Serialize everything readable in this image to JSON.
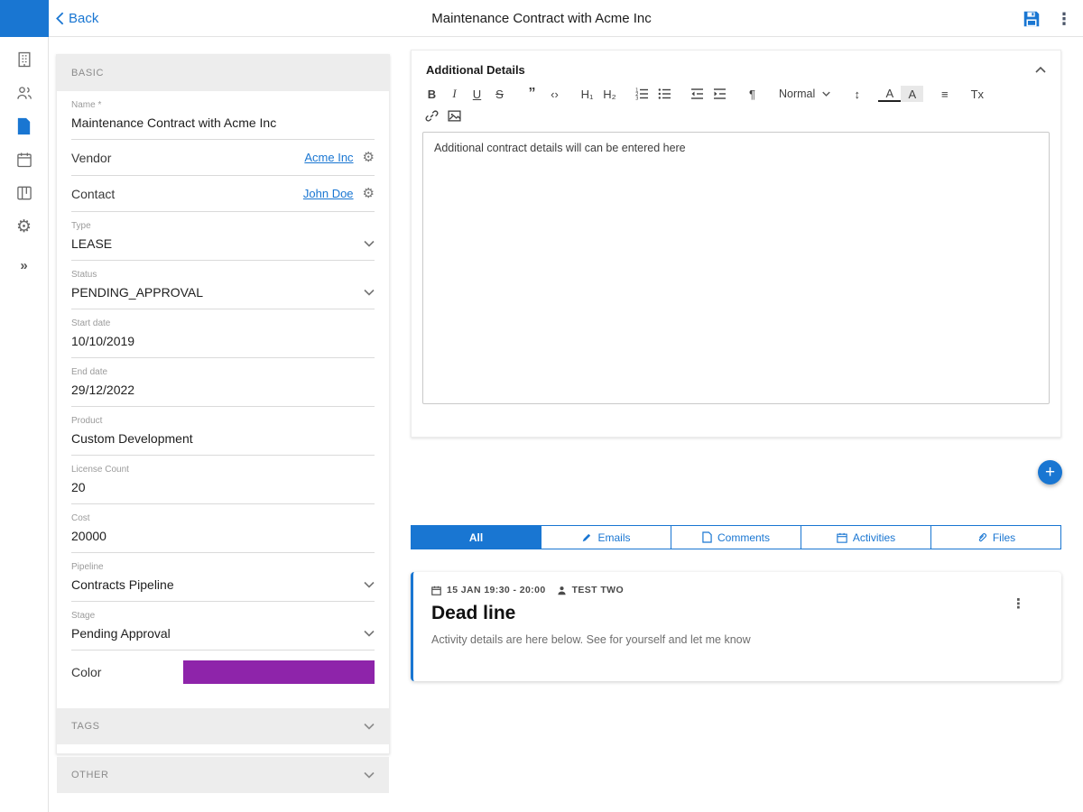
{
  "app_bar": {
    "back_label": "Back",
    "title": "Maintenance Contract with Acme Inc"
  },
  "sidebar": {
    "icons": [
      "building-icon",
      "contacts-icon",
      "document-icon",
      "calendar-icon",
      "kanban-icon",
      "gear-icon",
      "chevrons-right-icon"
    ],
    "active_item": "documents"
  },
  "form": {
    "section_basic": "BASIC",
    "section_tags": "TAGS",
    "section_other": "OTHER",
    "fields": {
      "name": {
        "label": "Name *",
        "value": "Maintenance Contract with Acme Inc"
      },
      "vendor": {
        "label": "Vendor",
        "link": "Acme Inc"
      },
      "contact": {
        "label": "Contact",
        "link": "John Doe"
      },
      "type": {
        "label": "Type",
        "value": "LEASE"
      },
      "status": {
        "label": "Status",
        "value": "PENDING_APPROVAL"
      },
      "start_date": {
        "label": "Start date",
        "value": "10/10/2019"
      },
      "end_date": {
        "label": "End date",
        "value": "29/12/2022"
      },
      "product": {
        "label": "Product",
        "value": "Custom Development"
      },
      "license_count": {
        "label": "License Count",
        "value": "20"
      },
      "cost": {
        "label": "Cost",
        "value": "20000"
      },
      "pipeline": {
        "label": "Pipeline",
        "value": "Contracts Pipeline"
      },
      "stage": {
        "label": "Stage",
        "value": "Pending Approval"
      },
      "color": {
        "label": "Color",
        "swatch_color": "#8e24aa"
      }
    }
  },
  "editor": {
    "title": "Additional Details",
    "content": "Additional contract details will can be entered here",
    "toolbar": {
      "bold": "B",
      "italic": "I",
      "underline": "U",
      "strike": "S",
      "blockquote": "”",
      "code": "‹›",
      "h1": "H₁",
      "h2": "H₂",
      "direction": "¶",
      "format": "Normal",
      "size": "↕",
      "color": "A",
      "background": "A",
      "align": "≡",
      "clean": "Tx"
    },
    "toolbar_icons": [
      "ordered-list-icon",
      "bullet-list-icon",
      "outdent-icon",
      "indent-icon",
      "link-icon",
      "image-icon"
    ]
  },
  "tabs": [
    {
      "label": "All",
      "active": true
    },
    {
      "label": "Emails",
      "icon": "pen-icon"
    },
    {
      "label": "Comments",
      "icon": "comment-icon"
    },
    {
      "label": "Activities",
      "icon": "calendar-icon"
    },
    {
      "label": "Files",
      "icon": "paperclip-icon"
    }
  ],
  "activity": {
    "datetime": "15 JAN 19:30 - 20:00",
    "user": "TEST TWO",
    "title": "Dead line",
    "body": "Activity details are here below. See for yourself and let me know"
  },
  "fab_label": "+",
  "colors": {
    "accent": "#1976d2",
    "swatch": "#8e24aa"
  }
}
